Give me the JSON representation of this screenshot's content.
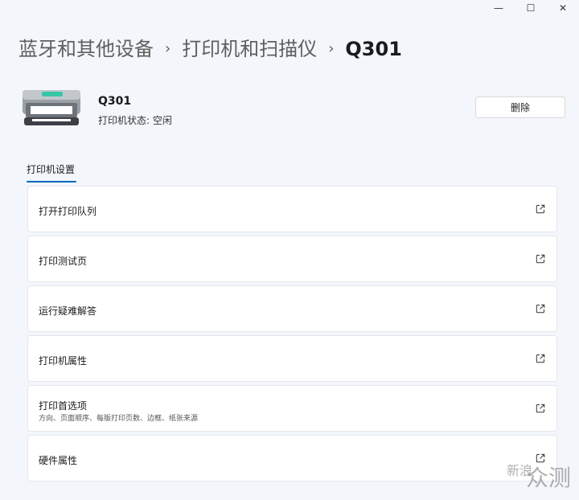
{
  "window": {
    "minimize": "—",
    "maximize": "☐",
    "close": "✕"
  },
  "breadcrumb": {
    "items": [
      "蓝牙和其他设备",
      "打印机和扫描仪",
      "Q301"
    ],
    "separator": "›"
  },
  "device": {
    "name": "Q301",
    "status": "打印机状态:  空闲",
    "delete_label": "删除"
  },
  "section": {
    "title": "打印机设置",
    "accent_color": "#0067c0"
  },
  "settings": [
    {
      "label": "打开打印队列",
      "icon": "external-link-icon"
    },
    {
      "label": "打印测试页",
      "icon": "external-link-icon"
    },
    {
      "label": "运行疑难解答",
      "icon": "external-link-icon"
    },
    {
      "label": "打印机属性",
      "icon": "external-link-icon"
    },
    {
      "label": "打印首选项",
      "description": "方向、页面顺序、每版打印页数、边框、纸张来源",
      "icon": "external-link-icon"
    },
    {
      "label": "硬件属性",
      "icon": "external-link-icon"
    }
  ],
  "watermark": {
    "small": "新浪",
    "big": "众测"
  }
}
